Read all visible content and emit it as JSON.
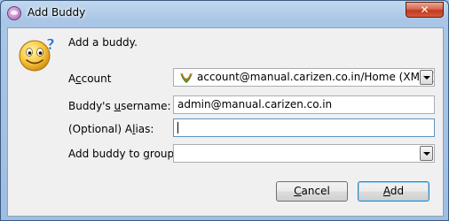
{
  "window": {
    "title": "Add Buddy"
  },
  "header": {
    "text": "Add a buddy."
  },
  "form": {
    "account": {
      "label_pre": "A",
      "label_u": "c",
      "label_post": "count",
      "value": "account@manual.carizen.co.in/Home (XMPP)"
    },
    "username": {
      "label_pre": "Buddy's ",
      "label_u": "u",
      "label_post": "sername:",
      "value": "admin@manual.carizen.co.in"
    },
    "alias": {
      "label_pre": "(Optional) A",
      "label_u": "l",
      "label_post": "ias:",
      "value": ""
    },
    "group": {
      "label_pre": "Add buddy to ",
      "label_u": "g",
      "label_post": "roup:",
      "value": ""
    }
  },
  "buttons": {
    "cancel": {
      "pre": "",
      "u": "C",
      "post": "ancel"
    },
    "add": {
      "pre": "",
      "u": "A",
      "post": "dd"
    }
  },
  "colors": {
    "titlebar": "#a9c6e6",
    "close": "#c0391f",
    "client": "#f0f0f0"
  },
  "icons": {
    "app": "pidgin-icon",
    "buddy": "smiley-question-icon",
    "account": "xmpp-icon",
    "close": "close-icon"
  }
}
